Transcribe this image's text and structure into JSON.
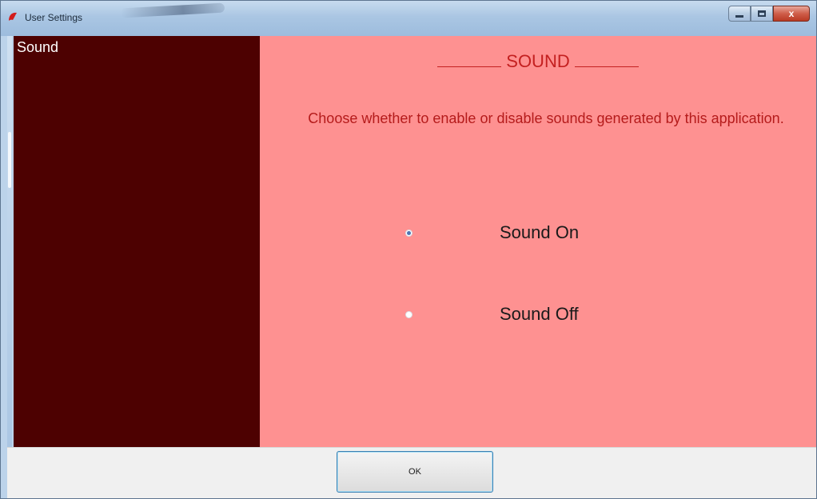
{
  "window": {
    "title": "User Settings",
    "controls": {
      "minimize": "–",
      "close": "x"
    }
  },
  "sidebar": {
    "items": [
      {
        "label": "Sound",
        "selected": true
      }
    ]
  },
  "main": {
    "heading": "SOUND",
    "description": "Choose whether to enable or disable sounds generated by this application.",
    "options": [
      {
        "label": "Sound On",
        "checked": true
      },
      {
        "label": "Sound Off",
        "checked": false
      }
    ]
  },
  "footer": {
    "ok_label": "OK"
  },
  "colors": {
    "sidebar_bg": "#4d0101",
    "content_bg": "#fe9191",
    "heading_text": "#c42020",
    "radio_dot": "#4d74b3"
  }
}
